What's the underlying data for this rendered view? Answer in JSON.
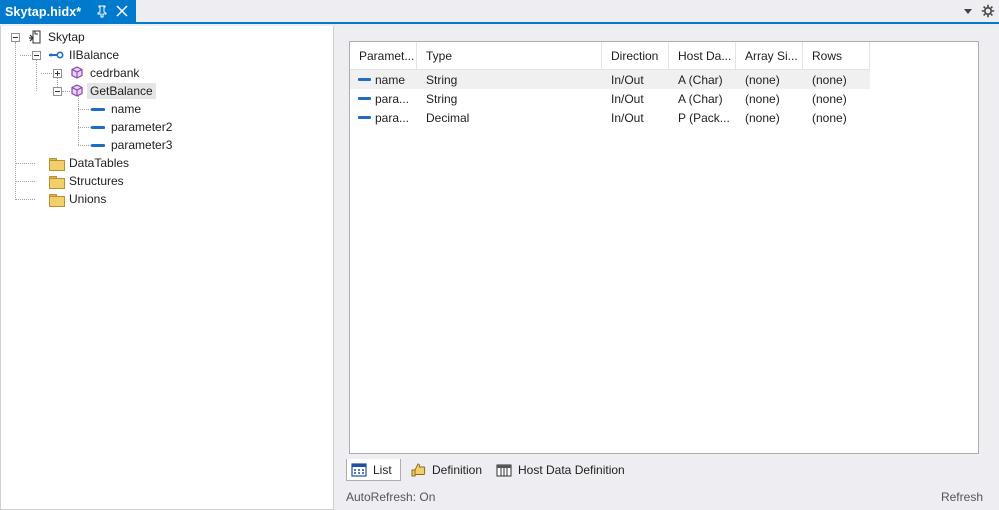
{
  "document_tab": {
    "title": "Skytap.hidx*"
  },
  "tree": {
    "root": "Skytap",
    "interface": "IIBalance",
    "methods": [
      {
        "label": "cedrbank"
      },
      {
        "label": "GetBalance"
      }
    ],
    "params": [
      "name",
      "parameter2",
      "parameter3"
    ],
    "folders": [
      "DataTables",
      "Structures",
      "Unions"
    ]
  },
  "grid": {
    "columns": [
      "Paramet...",
      "Type",
      "Direction",
      "Host Da...",
      "Array Si...",
      "Rows"
    ],
    "rows": [
      [
        "name",
        "String",
        "In/Out",
        "A (Char)",
        "(none)",
        "(none)"
      ],
      [
        "para...",
        "String",
        "In/Out",
        "A (Char)",
        "(none)",
        "(none)"
      ],
      [
        "para...",
        "Decimal",
        "In/Out",
        "P (Pack...",
        "(none)",
        "(none)"
      ]
    ]
  },
  "bottom_tabs": [
    {
      "label": "List",
      "icon": "list-grid-icon"
    },
    {
      "label": "Definition",
      "icon": "definition-icon"
    },
    {
      "label": "Host Data Definition",
      "icon": "host-data-icon"
    }
  ],
  "status": {
    "autorefresh": "AutoRefresh: On",
    "refresh": "Refresh"
  },
  "colors": {
    "accent": "#007acc",
    "param_dash": "#1e6ec8",
    "method_icon": "#8e44ad"
  }
}
